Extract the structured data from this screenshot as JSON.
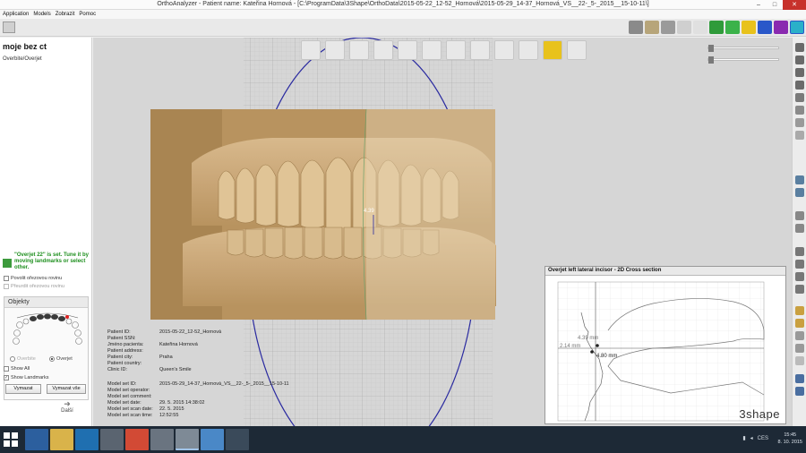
{
  "window": {
    "title": "OrthoAnalyzer - Patient name: Kateřina Hornová - [C:\\ProgramData\\3Shape\\OrthoData\\2015-05-22_12-52_Hornová\\2015-05-29_14-37_Hornová_VS__22-_5-_2015__15-10-11\\]",
    "min": "–",
    "max": "□",
    "close": "✕"
  },
  "menu": [
    "Application",
    "Models",
    "Zobrazit",
    "Pomoc"
  ],
  "left_panel": {
    "title": "moje bez ct",
    "subtitle": "Overbite/Overjet",
    "info_message": "\"Overjet 22\" is set.  Tune it by moving landmarks or select other.",
    "allow_cut_label": "Povolit ořezovou rovinu",
    "show_cut_label": "Přeurdit ořezovou rovinu",
    "objekty_title": "Objekty",
    "radio_overbite": "Overbite",
    "radio_overjet": "Overjet",
    "show_all": "Show All",
    "show_landmarks": "Show Landmarks",
    "btn_clear": "Vymazat",
    "btn_clear_all": "Vymazat vše",
    "next": "Další"
  },
  "measurement_tag": "4.39",
  "patient_info": [
    {
      "label": "Patient ID:",
      "value": "2015-05-22_12-52_Hornová"
    },
    {
      "label": "Patient SSN:",
      "value": ""
    },
    {
      "label": "Jméno pacienta:",
      "value": "Kateřina Hornová"
    },
    {
      "label": "Patient address:",
      "value": ""
    },
    {
      "label": "Patient city:",
      "value": "Praha"
    },
    {
      "label": "Patient country:",
      "value": ""
    },
    {
      "label": "Clinic ID:",
      "value": "Queen's Smile"
    }
  ],
  "model_info": [
    {
      "label": "Model set ID:",
      "value": "2015-05-29_14-37_Hornová_VS__22-_5-_2015__15-10-11"
    },
    {
      "label": "Model set operator:",
      "value": ""
    },
    {
      "label": "Model set comment:",
      "value": ""
    },
    {
      "label": "Model set date:",
      "value": "29. 5. 2015 14:38:02"
    },
    {
      "label": "Model set scan date:",
      "value": "22. 5. 2015"
    },
    {
      "label": "Model set scan time:",
      "value": "12:52:55"
    }
  ],
  "cross_section": {
    "title": "Overjet left lateral incisor - 2D Cross section",
    "label_1": "4.39 mm",
    "label_2": "2.14 mm",
    "label_3": "4.80 mm",
    "logo": "3shape"
  },
  "taskbar": {
    "lang": "CES",
    "time": "15:45",
    "date": "8. 10. 2015"
  },
  "colors": {
    "accent_green": "#1e8f1e",
    "model_tan": "#c9a677",
    "circle_blue": "#2a2aa0",
    "taskbar": "#1d2936"
  }
}
